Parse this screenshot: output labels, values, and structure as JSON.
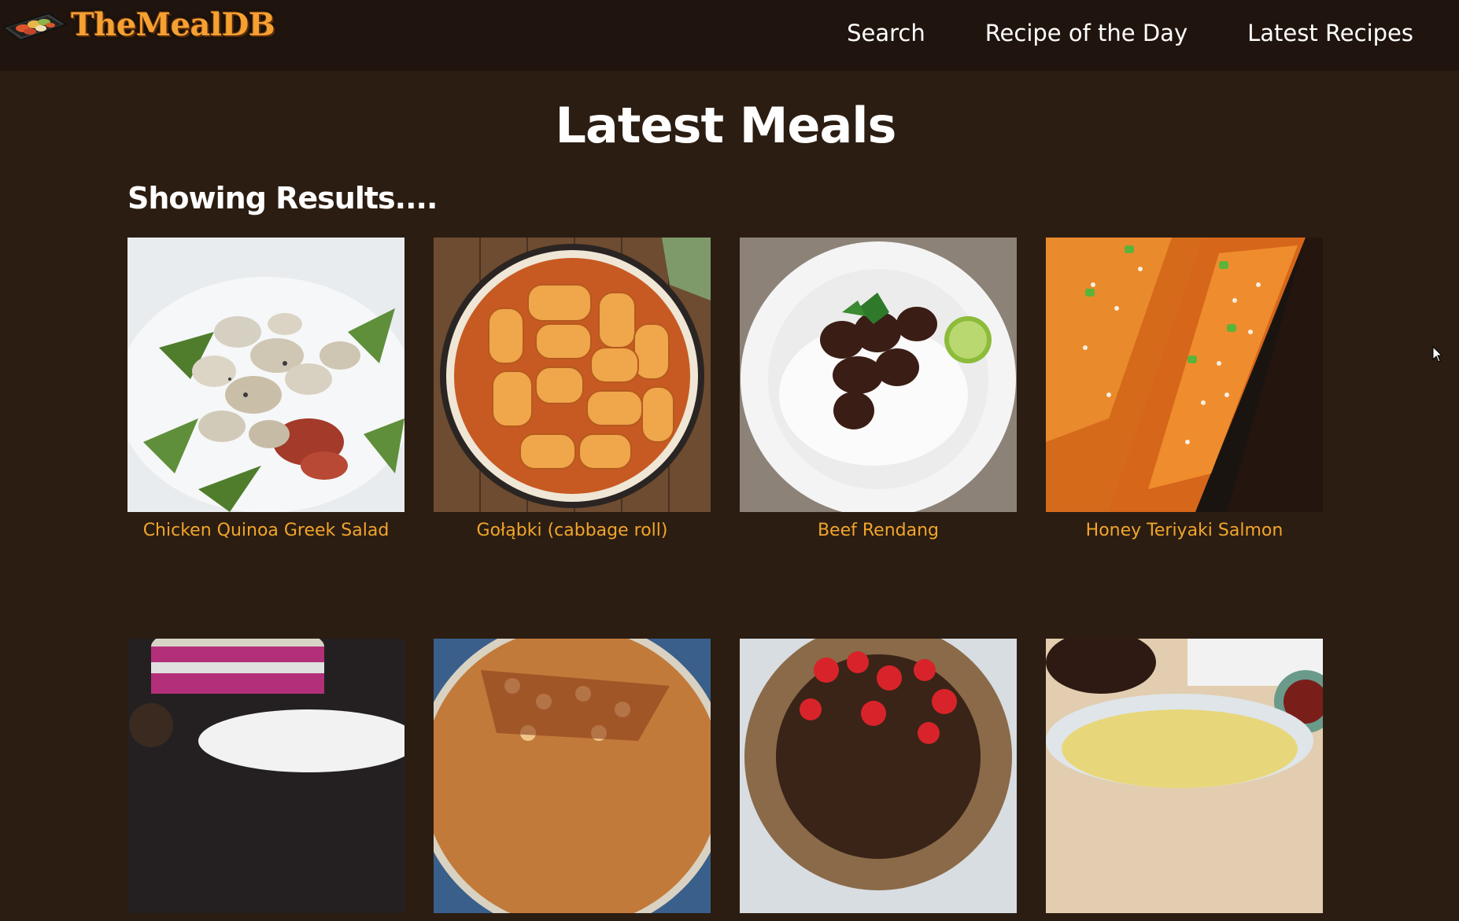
{
  "header": {
    "logo_text": "TheMealDB",
    "nav": [
      "Search",
      "Recipe of the Day",
      "Latest Recipes"
    ]
  },
  "main": {
    "title": "Latest Meals",
    "results_heading": "Showing Results...."
  },
  "meals": [
    {
      "name": "Chicken Quinoa Greek Salad"
    },
    {
      "name": "Gołąbki (cabbage roll)"
    },
    {
      "name": "Beef Rendang"
    },
    {
      "name": "Honey Teriyaki Salmon"
    },
    {
      "name": ""
    },
    {
      "name": ""
    },
    {
      "name": ""
    },
    {
      "name": ""
    }
  ],
  "colors": {
    "background": "#2b1d12",
    "navbar": "#20150e",
    "accent": "#f2a52a",
    "logo": "#f5a132"
  }
}
